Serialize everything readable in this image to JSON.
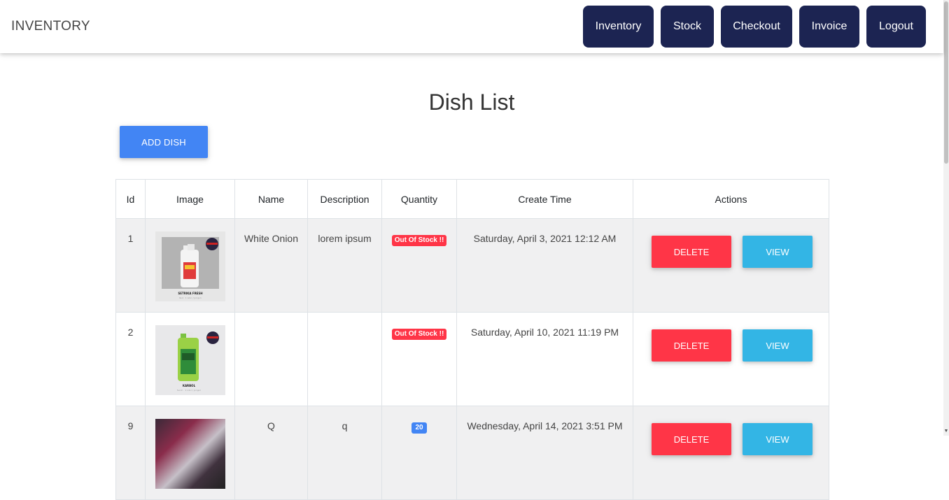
{
  "navbar": {
    "brand": "INVENTORY",
    "links": [
      "Inventory",
      "Stock",
      "Checkout",
      "Invoice",
      "Logout"
    ]
  },
  "page": {
    "title": "Dish List",
    "add_button": "ADD DISH"
  },
  "table": {
    "headers": [
      "Id",
      "Image",
      "Name",
      "Description",
      "Quantity",
      "Create Time",
      "Actions"
    ],
    "rows": [
      {
        "id": "1",
        "name": "White Onion",
        "description": "lorem ipsum",
        "quantity": "Out Of Stock !!",
        "create_time": "Saturday, April 3, 2021 12:12 AM",
        "product_label": "SETRIKA FRESH",
        "product_sub": "Red - 1 Liter / Jerigen"
      },
      {
        "id": "2",
        "name": "",
        "description": "",
        "quantity": "Out Of Stock !!",
        "create_time": "Saturday, April 10, 2021 11:19 PM",
        "product_label": "KARBOL",
        "product_sub": "Sereh - 1 Liter / Jerigen"
      },
      {
        "id": "9",
        "name": "Q",
        "description": "q",
        "quantity": "20",
        "create_time": "Wednesday, April 14, 2021 3:51 PM"
      }
    ],
    "delete_label": "DELETE",
    "view_label": "VIEW"
  },
  "colors": {
    "nav": "#1c2452",
    "primary": "#4285f4",
    "danger": "#ff3547",
    "info": "#33b5e5"
  }
}
